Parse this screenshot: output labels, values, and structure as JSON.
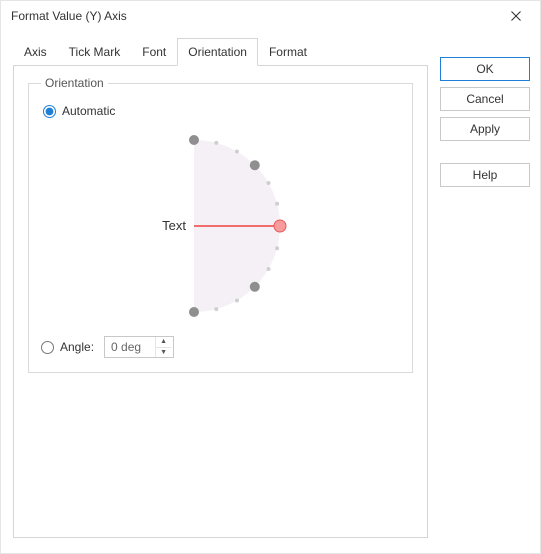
{
  "window": {
    "title": "Format Value (Y) Axis"
  },
  "tabs": {
    "axis": "Axis",
    "tick_mark": "Tick Mark",
    "font": "Font",
    "orientation": "Orientation",
    "format": "Format"
  },
  "orientation": {
    "legend": "Orientation",
    "automatic_label": "Automatic",
    "angle_label": "Angle:",
    "angle_value": "0 deg",
    "preview_text": "Text",
    "selected_option": "automatic"
  },
  "buttons": {
    "ok": "OK",
    "cancel": "Cancel",
    "apply": "Apply",
    "help": "Help"
  }
}
